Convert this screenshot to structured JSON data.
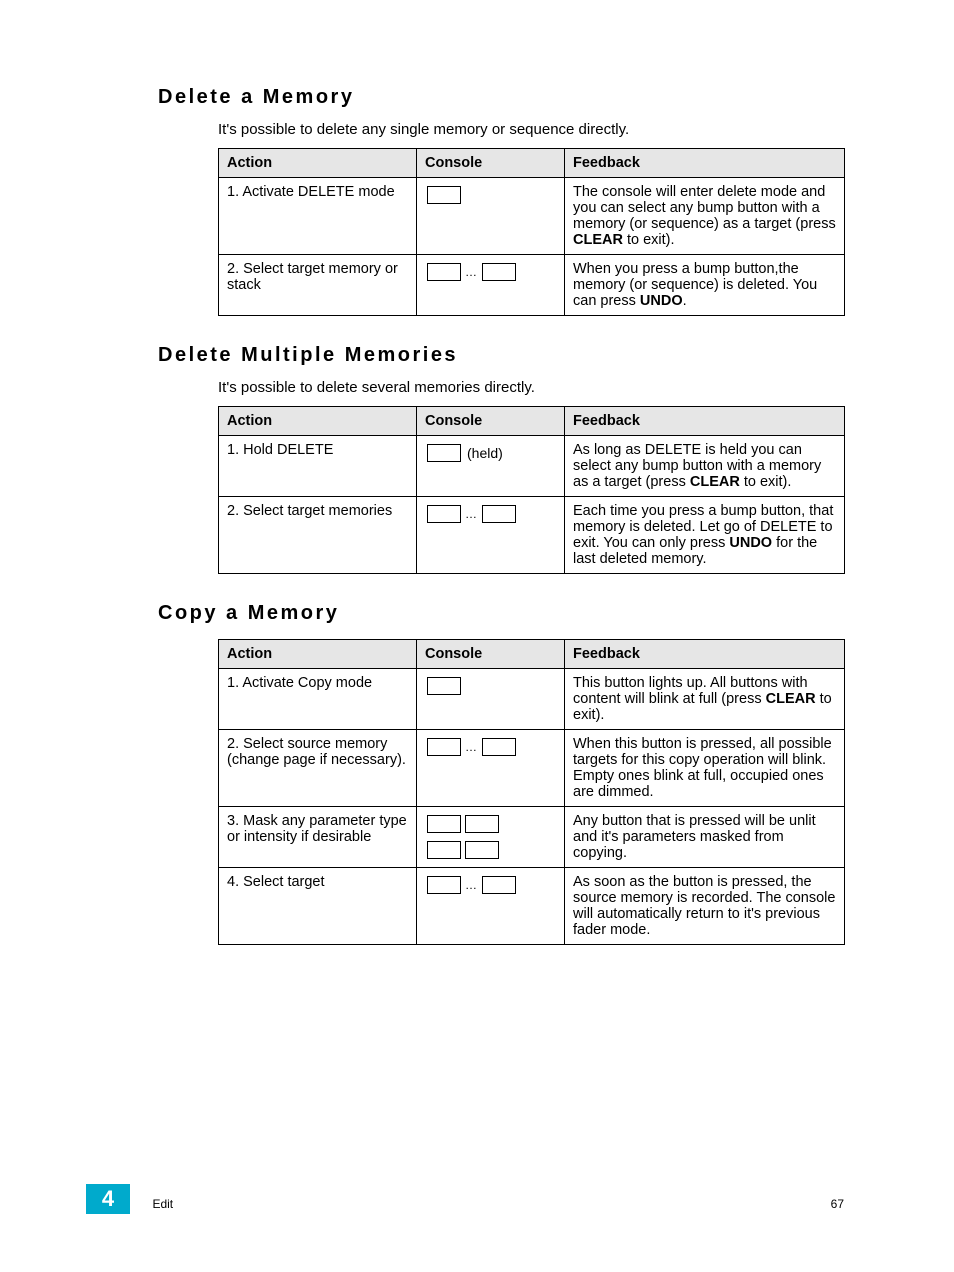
{
  "sections": [
    {
      "heading": "Delete a Memory",
      "intro": "It's possible to delete any single memory or sequence directly.",
      "headers": {
        "action": "Action",
        "console": "Console",
        "feedback": "Feedback"
      },
      "rows": [
        {
          "action": "1. Activate DELETE mode",
          "console_type": "single",
          "feedback_pre": "The console will enter delete mode and you can select any bump button with a memory (or sequence) as a target (press ",
          "feedback_bold": "CLEAR",
          "feedback_post": " to exit)."
        },
        {
          "action": "2. Select target memory or stack",
          "console_type": "dots",
          "feedback_pre": "When you press a bump button,the memory (or sequence) is deleted. You can press ",
          "feedback_bold": "UNDO",
          "feedback_post": "."
        }
      ]
    },
    {
      "heading": "Delete Multiple Memories",
      "intro": "It's possible to delete several memories directly.",
      "headers": {
        "action": "Action",
        "console": "Console",
        "feedback": "Feedback"
      },
      "rows": [
        {
          "action": "1. Hold DELETE",
          "console_type": "held",
          "held_label": "(held)",
          "feedback_pre": "As long as DELETE is held you can select any bump button with a memory as a target (press ",
          "feedback_bold": "CLEAR",
          "feedback_post": " to exit)."
        },
        {
          "action": "2. Select target memories",
          "console_type": "dots",
          "feedback_pre": "Each time you press a bump button, that memory is deleted. Let go of DELETE to exit. You can only press ",
          "feedback_bold": "UNDO",
          "feedback_post": " for the last deleted memory."
        }
      ]
    },
    {
      "heading": "Copy a Memory",
      "intro": "",
      "headers": {
        "action": "Action",
        "console": "Console",
        "feedback": "Feedback"
      },
      "rows": [
        {
          "action": "1. Activate Copy mode",
          "console_type": "single",
          "feedback_pre": "This button lights up. All buttons with content will blink at full (press ",
          "feedback_bold": "CLEAR",
          "feedback_post": " to exit)."
        },
        {
          "action": "2. Select source memory (change page if necessary).",
          "console_type": "dots",
          "feedback_plain": "When this button is pressed, all possible targets for this copy operation will blink. Empty ones blink at full, occupied ones are dimmed."
        },
        {
          "action": "3. Mask any parameter type or intensity if desirable",
          "console_type": "grid4",
          "feedback_plain": "Any button that is pressed will be unlit and it's parameters masked from copying."
        },
        {
          "action": "4. Select target",
          "console_type": "dots",
          "feedback_plain": "As soon as the button is pressed, the source memory is recorded. The console will automatically return to it's previous fader mode."
        }
      ]
    }
  ],
  "footer": {
    "chapter_number": "4",
    "chapter_title": "Edit",
    "page_number": "67"
  },
  "dots_glyph": "…"
}
